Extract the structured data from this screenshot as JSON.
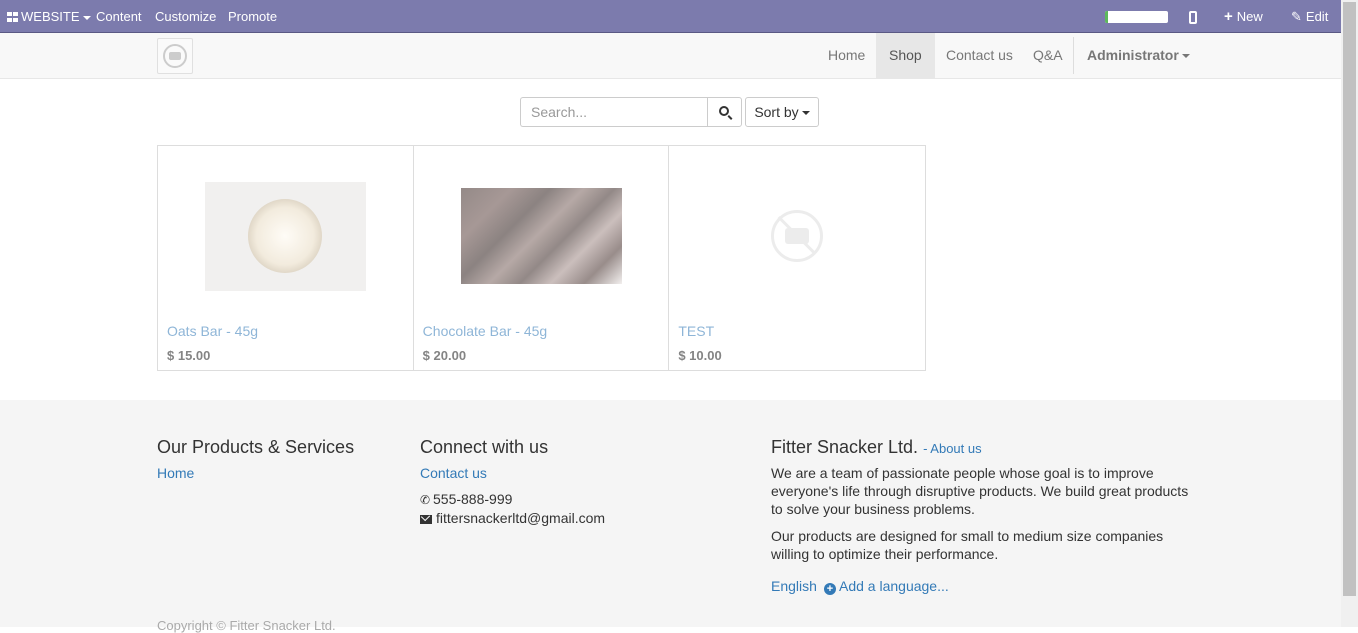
{
  "topbar": {
    "website_label": "WEBSITE",
    "content_label": "Content",
    "customize_label": "Customize",
    "promote_label": "Promote",
    "new_label": "New",
    "edit_label": "Edit",
    "progress_fraction": 0.05,
    "progress_color": "#5cb85c",
    "bar_color": "#7c7bad"
  },
  "navbar": {
    "items": [
      {
        "label": "Home"
      },
      {
        "label": "Shop",
        "active": true
      },
      {
        "label": "Contact us"
      },
      {
        "label": "Q&A"
      }
    ],
    "user_label": "Administrator"
  },
  "search": {
    "placeholder": "Search...",
    "sort_label": "Sort by"
  },
  "products": [
    {
      "name": "Oats Bar - 45g",
      "price": "$ 15.00",
      "image": "oats-bowl"
    },
    {
      "name": "Chocolate Bar - 45g",
      "price": "$ 20.00",
      "image": "chocolate-pieces"
    },
    {
      "name": "TEST",
      "price": "$ 10.00",
      "image": "placeholder-camera-icon"
    }
  ],
  "footer": {
    "products_heading": "Our Products & Services",
    "products_link": "Home",
    "connect_heading": "Connect with us",
    "contact_link": "Contact us",
    "phone": "555-888-999",
    "email": "fittersnackerltd@gmail.com",
    "company_heading": "Fitter Snacker Ltd.",
    "about_link": "- About us",
    "about_text_1": "We are a team of passionate people whose goal is to improve everyone's life through disruptive products. We build great products to solve your business problems.",
    "about_text_2": "Our products are designed for small to medium size companies willing to optimize their performance.",
    "language": "English",
    "add_language": "Add a language...",
    "copyright": "Copyright © Fitter Snacker Ltd."
  }
}
